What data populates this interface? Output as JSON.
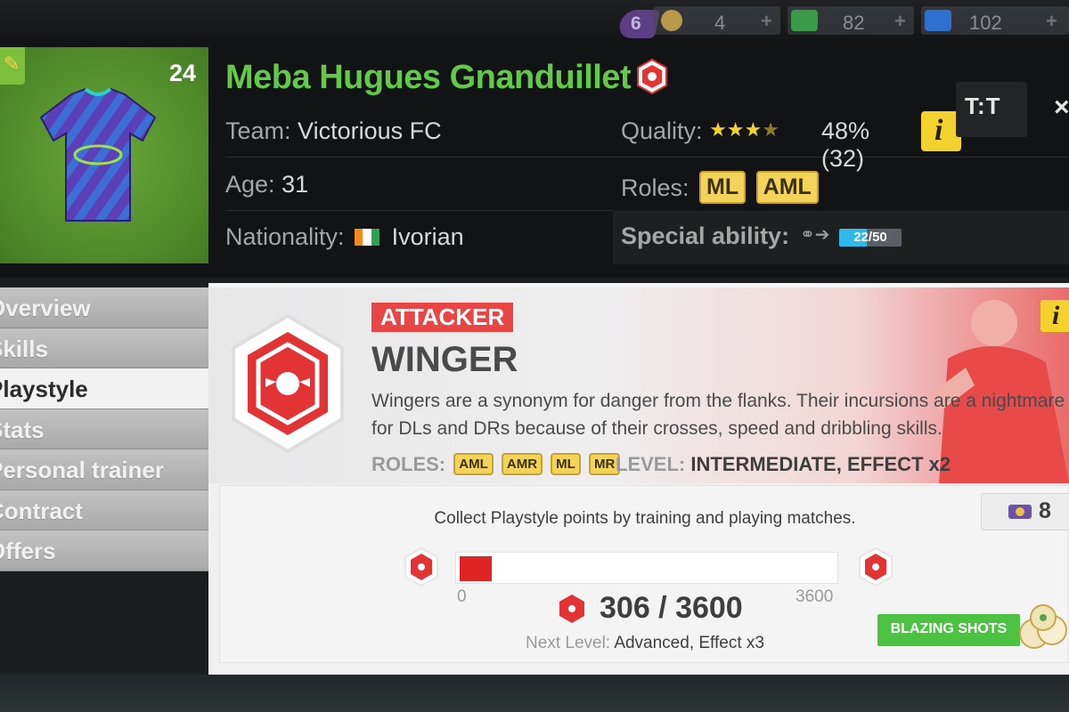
{
  "resources": {
    "badge_count": "6",
    "items": [
      {
        "icon": "training-coin-icon",
        "value": "4",
        "color": "#c8a24a"
      },
      {
        "icon": "stopwatch-icon",
        "value": "82",
        "color": "#3a9a4a"
      },
      {
        "icon": "energy-icon",
        "value": "102",
        "color": "#2e6fd0"
      }
    ],
    "plus": "+"
  },
  "player": {
    "shirt_number": "24",
    "name": "Meba Hugues Gnanduillet",
    "team_label": "Team:",
    "team": "Victorious FC",
    "age_label": "Age:",
    "age": "31",
    "nationality_label": "Nationality:",
    "nationality": "Ivorian",
    "quality_label": "Quality:",
    "quality_value": "48% (32)",
    "roles_label": "Roles:",
    "roles": [
      "ML",
      "AML"
    ],
    "special_label": "Special ability:",
    "special_progress": "22/50",
    "special_fraction": 0.44,
    "edit_icon": "pencil-icon",
    "info_icon": "info-icon"
  },
  "header_actions": {
    "kit_label": "T:T",
    "close_label": "×"
  },
  "sidebar": {
    "items": [
      {
        "label": "Overview",
        "active": false
      },
      {
        "label": "Skills",
        "active": false
      },
      {
        "label": "Playstyle",
        "active": true
      },
      {
        "label": "Stats",
        "active": false
      },
      {
        "label": "Personal trainer",
        "active": false
      },
      {
        "label": "Contract",
        "active": false
      },
      {
        "label": "Offers",
        "active": false
      }
    ]
  },
  "playstyle": {
    "category": "ATTACKER",
    "name": "WINGER",
    "description": "Wingers are a synonym for danger from the flanks. Their incursions are a nightmare for DLs and DRs because of their crosses, speed and dribbling skills.",
    "roles_label": "ROLES:",
    "roles": [
      "AML",
      "AMR",
      "ML",
      "MR"
    ],
    "level_label": "LEVEL:",
    "level_value": "INTERMEDIATE, EFFECT x2",
    "collect_text": "Collect Playstyle points by training and playing matches.",
    "counter": "8",
    "bar_min": "0",
    "bar_max": "3600",
    "points": "306 / 3600",
    "progress_fraction": 0.085,
    "next_label": "Next Level:",
    "next_value": "Advanced, Effect x3",
    "cta": "BLAZING SHOTS"
  },
  "colors": {
    "accent_green": "#62c94a",
    "accent_red": "#e84545",
    "chip_yellow": "#f4d35a",
    "cta_green": "#4cc243"
  }
}
